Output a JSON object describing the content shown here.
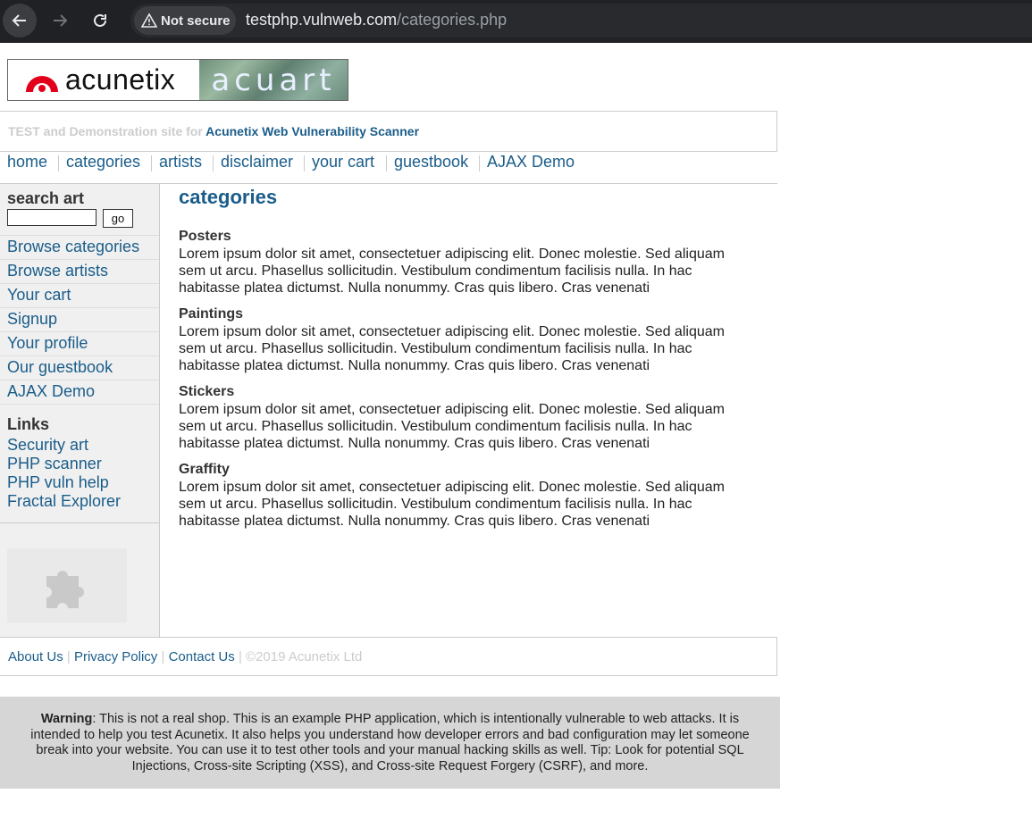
{
  "browser": {
    "security_label": "Not secure",
    "url_host": "testphp.vulnweb.com",
    "url_path": "/categories.php"
  },
  "logo": {
    "brand": "acunetix",
    "product": "acuart"
  },
  "tagline": {
    "prefix": "TEST and Demonstration site for ",
    "scanner": "Acunetix Web Vulnerability Scanner"
  },
  "topnav": [
    "home",
    "categories",
    "artists",
    "disclaimer",
    "your cart",
    "guestbook",
    "AJAX Demo"
  ],
  "sidebar": {
    "search_title": "search art",
    "search_value": "",
    "go_label": "go",
    "menu": [
      "Browse categories",
      "Browse artists",
      "Your cart",
      "Signup",
      "Your profile",
      "Our guestbook",
      "AJAX Demo"
    ],
    "links_title": "Links",
    "links": [
      "Security art",
      "PHP scanner",
      "PHP vuln help",
      "Fractal Explorer"
    ],
    "plugin_icon": "puzzle-icon"
  },
  "main": {
    "title": "categories",
    "categories": [
      {
        "name": "Posters",
        "description": "Lorem ipsum dolor sit amet, consectetuer adipiscing elit. Donec molestie. Sed aliquam sem ut arcu. Phasellus sollicitudin. Vestibulum condimentum facilisis nulla. In hac habitasse platea dictumst. Nulla nonummy. Cras quis libero. Cras venenati"
      },
      {
        "name": "Paintings",
        "description": "Lorem ipsum dolor sit amet, consectetuer adipiscing elit. Donec molestie. Sed aliquam sem ut arcu. Phasellus sollicitudin. Vestibulum condimentum facilisis nulla. In hac habitasse platea dictumst. Nulla nonummy. Cras quis libero. Cras venenati"
      },
      {
        "name": "Stickers",
        "description": "Lorem ipsum dolor sit amet, consectetuer adipiscing elit. Donec molestie. Sed aliquam sem ut arcu. Phasellus sollicitudin. Vestibulum condimentum facilisis nulla. In hac habitasse platea dictumst. Nulla nonummy. Cras quis libero. Cras venenati"
      },
      {
        "name": "Graffity",
        "description": "Lorem ipsum dolor sit amet, consectetuer adipiscing elit. Donec molestie. Sed aliquam sem ut arcu. Phasellus sollicitudin. Vestibulum condimentum facilisis nulla. In hac habitasse platea dictumst. Nulla nonummy. Cras quis libero. Cras venenati"
      }
    ]
  },
  "footer": {
    "links": [
      "About Us",
      "Privacy Policy",
      "Contact Us"
    ],
    "separator": "|",
    "copyright": "©2019 Acunetix Ltd"
  },
  "warning": {
    "label": "Warning",
    "text": ": This is not a real shop. This is an example PHP application, which is intentionally vulnerable to web attacks. It is intended to help you test Acunetix. It also helps you understand how developer errors and bad configuration may let someone break into your website. You can use it to test other tools and your manual hacking skills as well. Tip: Look for potential SQL Injections, Cross-site Scripting (XSS), and Cross-site Request Forgery (CSRF), and more."
  },
  "colors": {
    "link": "#1a5d8a",
    "chrome_bg": "#202124",
    "warning_bg": "#d6d6d6"
  }
}
